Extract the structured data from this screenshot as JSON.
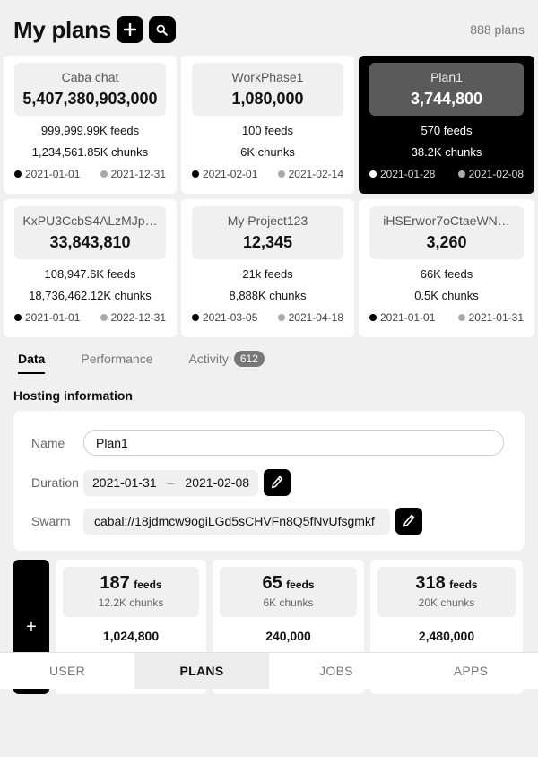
{
  "header": {
    "title": "My plans",
    "add_icon": "plus-icon",
    "search_icon": "search-icon",
    "plan_count": "888 plans"
  },
  "plans": [
    {
      "name": "Caba chat",
      "value": "5,407,380,903,000",
      "feeds": "999,999.99K feeds",
      "chunks": "1,234,561.85K chunks",
      "start": "2021-01-01",
      "end": "2021-12-31",
      "active": false
    },
    {
      "name": "WorkPhase1",
      "value": "1,080,000",
      "feeds": "100 feeds",
      "chunks": "6K chunks",
      "start": "2021-02-01",
      "end": "2021-02-14",
      "active": false
    },
    {
      "name": "Plan1",
      "value": "3,744,800",
      "feeds": "570 feeds",
      "chunks": "38.2K chunks",
      "start": "2021-01-28",
      "end": "2021-02-08",
      "active": true
    },
    {
      "name": "KxPU3CcbS4ALzMJp…",
      "value": "33,843,810",
      "feeds": "108,947.6K feeds",
      "chunks": "18,736,462.12K chunks",
      "start": "2021-01-01",
      "end": "2022-12-31",
      "active": false
    },
    {
      "name": "My Project123",
      "value": "12,345",
      "feeds": "21k feeds",
      "chunks": "8,888K chunks",
      "start": "2021-03-05",
      "end": "2021-04-18",
      "active": false
    },
    {
      "name": "iHSErwor7oCtaeWN…",
      "value": "3,260",
      "feeds": "66K feeds",
      "chunks": "0.5K chunks",
      "start": "2021-01-01",
      "end": "2021-01-31",
      "active": false
    }
  ],
  "tabs": [
    {
      "label": "Data",
      "active": true
    },
    {
      "label": "Performance",
      "active": false
    },
    {
      "label": "Activity",
      "badge": "612",
      "active": false
    }
  ],
  "hosting": {
    "section_title": "Hosting information",
    "name_label": "Name",
    "name_value": "Plan1",
    "duration_label": "Duration",
    "duration_start": "2021-01-31",
    "duration_sep": "–",
    "duration_end": "2021-02-08",
    "swarm_label": "Swarm",
    "swarm_value": "cabal://18jdmcw9ogiLGd5sCHVFn8Q5fNvUfsgmkf",
    "edit_icon": "pencil-icon"
  },
  "feeds_add_label": "+",
  "feeds": [
    {
      "count": "187",
      "unit": "feeds",
      "chunks": "12.2K chunks",
      "total": "1,024,800"
    },
    {
      "count": "65",
      "unit": "feeds",
      "chunks": "6K chunks",
      "total": "240,000"
    },
    {
      "count": "318",
      "unit": "feeds",
      "chunks": "20K chunks",
      "total": "2,480,000"
    }
  ],
  "nav": [
    {
      "label": "USER",
      "active": false
    },
    {
      "label": "PLANS",
      "active": true
    },
    {
      "label": "JOBS",
      "active": false
    },
    {
      "label": "APPS",
      "active": false
    }
  ],
  "colors": {
    "accent": "#000000",
    "active_card_head": "#5a5a5a",
    "background": "#f0f0f0",
    "badge": "#777777"
  }
}
